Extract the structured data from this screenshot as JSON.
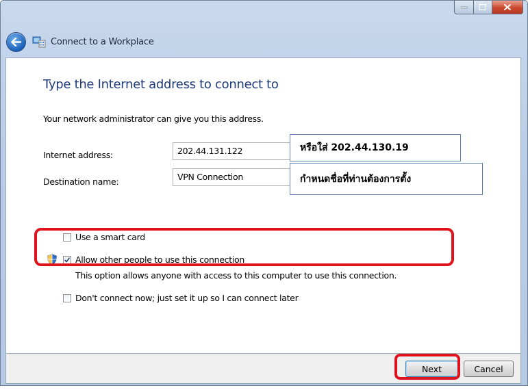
{
  "window": {
    "title": "Connect to a Workplace"
  },
  "page": {
    "heading": "Type the Internet address to connect to",
    "description": "Your network administrator can give you this address."
  },
  "form": {
    "internet_address_label": "Internet address:",
    "internet_address_value": "202.44.131.122",
    "destination_name_label": "Destination name:",
    "destination_name_value": "VPN Connection"
  },
  "annotations": {
    "address_note": "หรือใส่  202.44.130.19",
    "name_note": "กำหนดชื่อที่ท่านต้องการตั้ง"
  },
  "options": {
    "smart_card": {
      "label": "Use a smart card",
      "checked": false
    },
    "allow_others": {
      "label": "Allow other people to use this connection",
      "description": "This option allows anyone with access to this computer to use this connection.",
      "checked": true
    },
    "dont_connect": {
      "label": "Don't connect now; just set it up so I can connect later",
      "checked": false
    }
  },
  "buttons": {
    "next": "Next",
    "cancel": "Cancel"
  },
  "colors": {
    "highlight": "#e0121b",
    "heading": "#1f3b7a",
    "callout_border": "#5b7fb3"
  }
}
